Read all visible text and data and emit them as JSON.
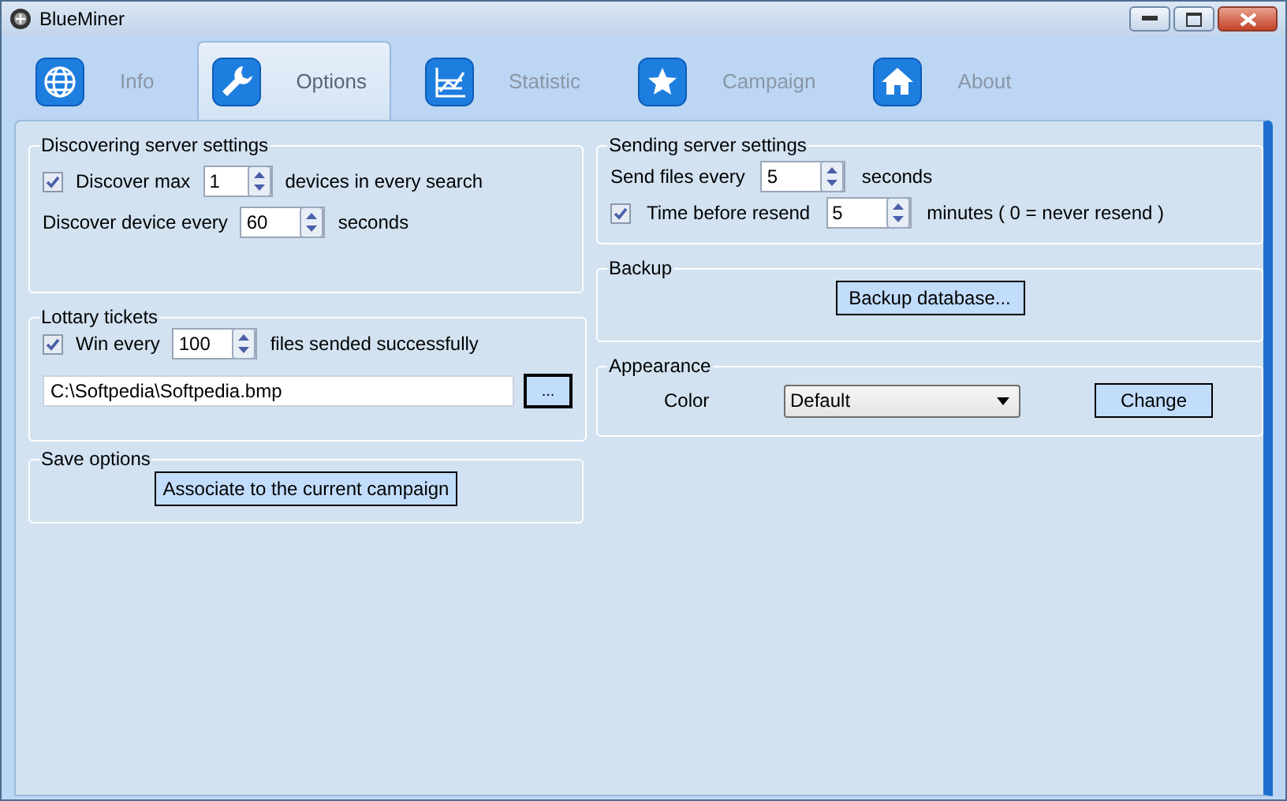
{
  "window": {
    "title": "BlueMiner"
  },
  "tabs": [
    {
      "label": "Info",
      "selected": false
    },
    {
      "label": "Options",
      "selected": true
    },
    {
      "label": "Statistic",
      "selected": false
    },
    {
      "label": "Campaign",
      "selected": false
    },
    {
      "label": "About",
      "selected": false
    }
  ],
  "discovering": {
    "title": "Discovering server settings",
    "discover_max": {
      "checked": true,
      "label": "Discover max",
      "value": "1",
      "suffix": "devices in every search"
    },
    "discover_every": {
      "label": "Discover device every",
      "value": "60",
      "suffix": "seconds"
    }
  },
  "lottery": {
    "title": "Lottary tickets",
    "win_every": {
      "checked": true,
      "label": "Win every",
      "value": "100",
      "suffix": "files sended successfully"
    },
    "path": "C:\\Softpedia\\Softpedia.bmp",
    "browse_button": "..."
  },
  "save_options": {
    "title": "Save options",
    "button": "Associate to the current campaign"
  },
  "sending": {
    "title": "Sending server settings",
    "send_every": {
      "label": "Send files every",
      "value": "5",
      "suffix": "seconds"
    },
    "resend": {
      "checked": true,
      "label": "Time before resend",
      "value": "5",
      "suffix": "minutes ( 0 = never resend )"
    }
  },
  "backup": {
    "title": "Backup",
    "button": "Backup database..."
  },
  "appearance": {
    "title": "Appearance",
    "label": "Color",
    "dropdown": "Default",
    "button": "Change"
  }
}
